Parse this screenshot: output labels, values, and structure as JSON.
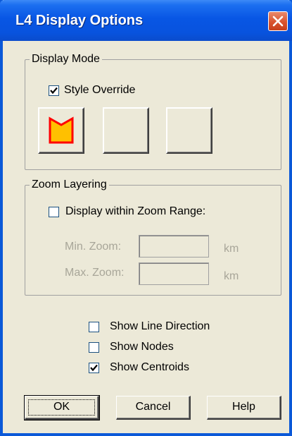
{
  "window": {
    "title": "L4 Display Options",
    "titlebar_color": "#0853de"
  },
  "display_mode": {
    "label": "Display Mode",
    "style_override": {
      "label": "Style Override",
      "checked": true
    },
    "style_buttons": [
      {
        "icon": "polygon-style-icon",
        "fill": "#ffc000",
        "stroke": "#ff0000"
      },
      {
        "icon": "blank"
      },
      {
        "icon": "blank"
      }
    ]
  },
  "zoom_layering": {
    "label": "Zoom Layering",
    "display_within": {
      "label": "Display within Zoom Range:",
      "checked": false
    },
    "min_zoom": {
      "label": "Min. Zoom:",
      "value": "",
      "unit": "km"
    },
    "max_zoom": {
      "label": "Max. Zoom:",
      "value": "",
      "unit": "km"
    }
  },
  "options": [
    {
      "label": "Show Line Direction",
      "checked": false
    },
    {
      "label": "Show Nodes",
      "checked": false
    },
    {
      "label": "Show Centroids",
      "checked": true
    }
  ],
  "buttons": {
    "ok": "OK",
    "cancel": "Cancel",
    "help": "Help"
  }
}
